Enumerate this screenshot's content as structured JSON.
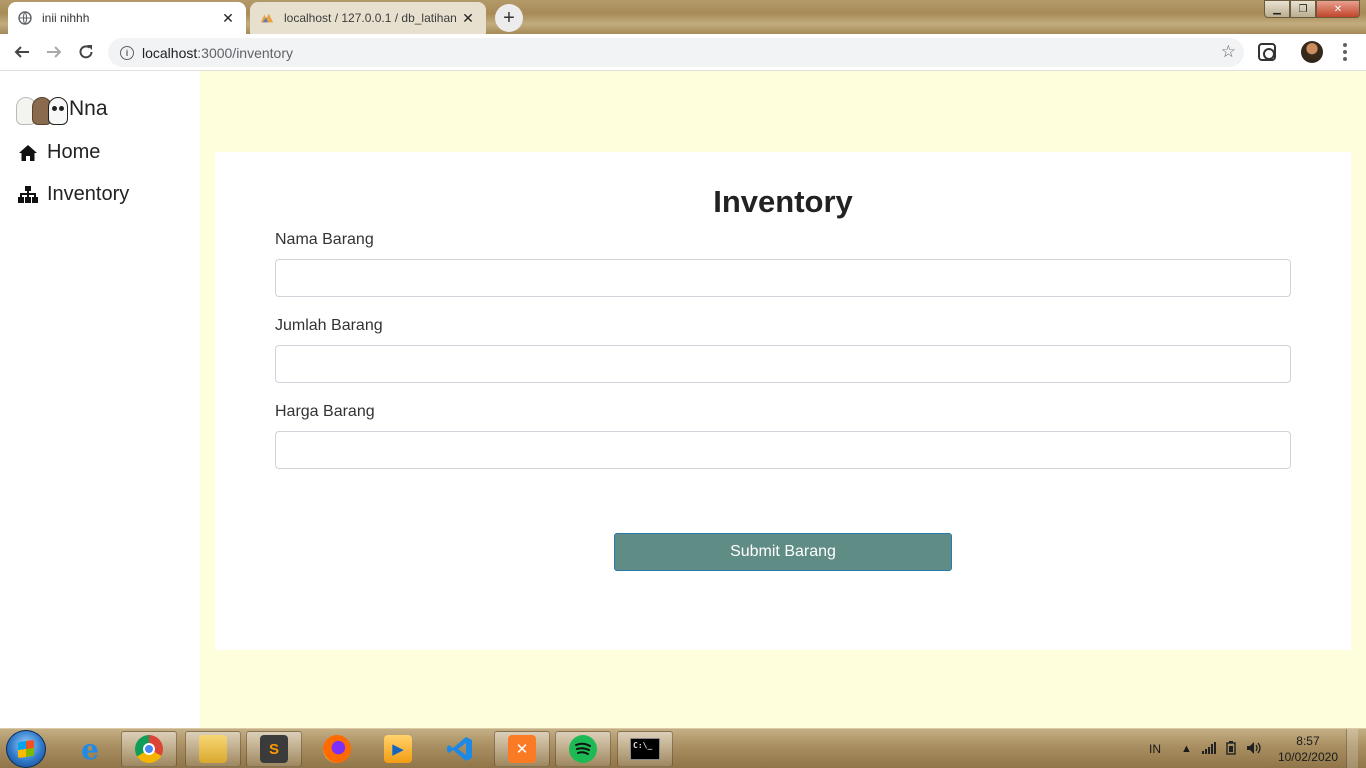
{
  "browser": {
    "tabs": [
      {
        "title": "inii nihhh",
        "close": "✕"
      },
      {
        "title": "localhost / 127.0.0.1 / db_latihan",
        "close": "✕"
      }
    ],
    "new_tab": "+",
    "url_host": "localhost",
    "url_path": ":3000/inventory",
    "window_buttons": {
      "minimize": "▁",
      "maximize": "❐",
      "close": "✕"
    }
  },
  "sidebar": {
    "brand": "Nna",
    "items": [
      {
        "label": "Home",
        "icon": "home-icon"
      },
      {
        "label": "Inventory",
        "icon": "sitemap-icon"
      }
    ]
  },
  "form": {
    "title": "Inventory",
    "fields": [
      {
        "label": "Nama Barang",
        "value": ""
      },
      {
        "label": "Jumlah Barang",
        "value": ""
      },
      {
        "label": "Harga Barang",
        "value": ""
      }
    ],
    "submit_label": "Submit Barang"
  },
  "taskbar": {
    "apps": [
      "internet-explorer",
      "chrome",
      "file-explorer",
      "sublime-text",
      "firefox",
      "media-player",
      "vscode",
      "xampp",
      "spotify",
      "command-prompt"
    ],
    "cmd_label": "C:\\_",
    "language": "IN",
    "time": "8:57",
    "date": "10/02/2020"
  },
  "colors": {
    "page_background": "#fefedd",
    "submit_button": "#5f8c85",
    "submit_border": "#2a78b0"
  }
}
